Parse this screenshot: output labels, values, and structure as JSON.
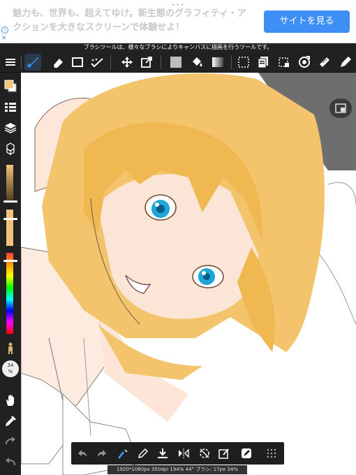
{
  "ad": {
    "text": "魅力も、世界も、超えてゆけ。新生態のグラフィティ・アクションを大きなスクリーンで体験せよ！",
    "button_label": "サイトを見る",
    "info_glyph": "i",
    "close_glyph": "✕",
    "dots": "•••"
  },
  "tooltip": {
    "text": "ブラシツールは、様々なブラシによりキャンバスに描画を行うツールです。"
  },
  "toolbar": {
    "icons": [
      "menu-icon",
      "brush-icon",
      "eraser-icon",
      "rectangle-icon",
      "dots-icon",
      "move-icon",
      "transform-icon",
      "fill-swatch-icon",
      "bucket-icon",
      "gradient-icon",
      "select-icon",
      "layer-copy-icon",
      "select-dash-icon",
      "lasso-icon",
      "ruler-icon",
      "pen-icon"
    ],
    "active": "brush-icon"
  },
  "sidebar": {
    "zoom_value": "34",
    "zoom_unit": "%",
    "color_primary": "#f2c37a",
    "color_secondary": "#ffffff"
  },
  "canvas": {
    "hair_color": "#f3c46b",
    "skin_color": "#fbe5d6",
    "eye_color": "#1fa6d8"
  },
  "status": {
    "text": "1920*1080px 350dpi 194% 44° ブラシ: 17px 34%"
  }
}
